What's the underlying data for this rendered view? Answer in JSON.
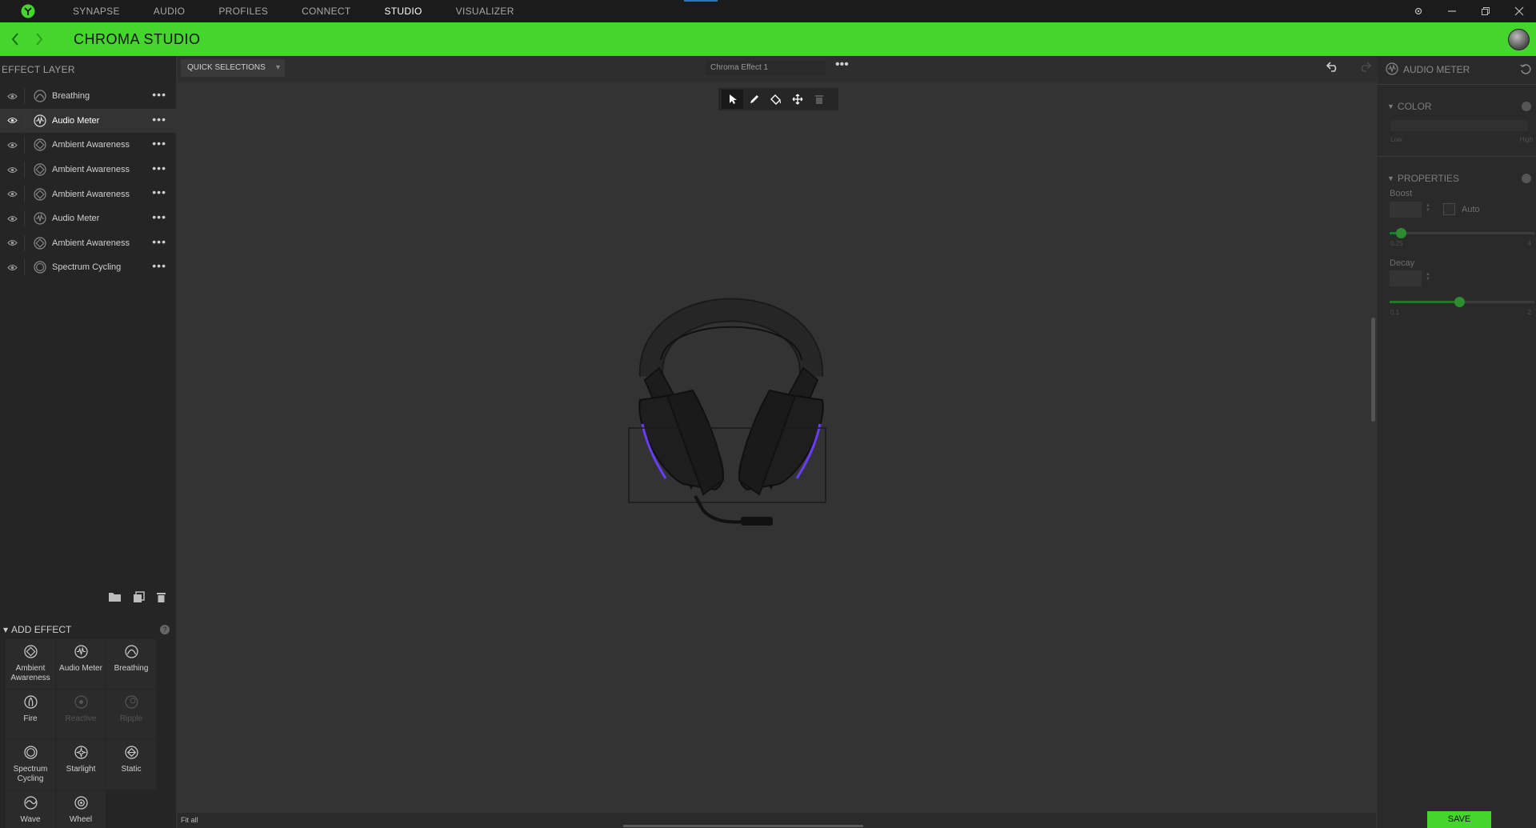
{
  "topnav": {
    "items": [
      "SYNAPSE",
      "AUDIO",
      "PROFILES",
      "CONNECT",
      "STUDIO",
      "VISUALIZER"
    ],
    "active": "STUDIO"
  },
  "header": {
    "title": "CHROMA STUDIO"
  },
  "left_panel": {
    "title": "EFFECT LAYER",
    "layers": [
      {
        "name": "Breathing",
        "icon": "breathing-icon"
      },
      {
        "name": "Audio Meter",
        "icon": "audio-meter-icon",
        "selected": true
      },
      {
        "name": "Ambient Awareness",
        "icon": "ambient-awareness-icon"
      },
      {
        "name": "Ambient Awareness",
        "icon": "ambient-awareness-icon"
      },
      {
        "name": "Ambient Awareness",
        "icon": "ambient-awareness-icon"
      },
      {
        "name": "Audio Meter",
        "icon": "audio-meter-icon"
      },
      {
        "name": "Ambient Awareness",
        "icon": "ambient-awareness-icon"
      },
      {
        "name": "Spectrum Cycling",
        "icon": "spectrum-cycling-icon"
      }
    ],
    "more_glyph": "•••",
    "add_effect_title": "ADD EFFECT",
    "effects": [
      {
        "line1": "Ambient",
        "line2": "Awareness",
        "enabled": true,
        "icon": "ambient-awareness-icon"
      },
      {
        "line1": "Audio Meter",
        "line2": "",
        "enabled": true,
        "icon": "audio-meter-icon"
      },
      {
        "line1": "Breathing",
        "line2": "",
        "enabled": true,
        "icon": "breathing-icon"
      },
      {
        "line1": "Fire",
        "line2": "",
        "enabled": true,
        "icon": "fire-icon"
      },
      {
        "line1": "Reactive",
        "line2": "",
        "enabled": false,
        "icon": "reactive-icon"
      },
      {
        "line1": "Ripple",
        "line2": "",
        "enabled": false,
        "icon": "ripple-icon"
      },
      {
        "line1": "Spectrum",
        "line2": "Cycling",
        "enabled": true,
        "icon": "spectrum-cycling-icon"
      },
      {
        "line1": "Starlight",
        "line2": "",
        "enabled": true,
        "icon": "starlight-icon"
      },
      {
        "line1": "Static",
        "line2": "",
        "enabled": true,
        "icon": "static-icon"
      },
      {
        "line1": "Wave",
        "line2": "",
        "enabled": true,
        "icon": "wave-icon"
      },
      {
        "line1": "Wheel",
        "line2": "",
        "enabled": true,
        "icon": "wheel-icon"
      }
    ]
  },
  "canvas": {
    "quick_selections": "QUICK SELECTIONS",
    "effect_name": "Chroma Effect 1",
    "more_glyph": "•••",
    "fit": "Fit all",
    "device": "headset",
    "accent_color": "#6a3cff"
  },
  "right_panel": {
    "title": "AUDIO METER",
    "color_section": "COLOR",
    "low": "Low",
    "high": "High",
    "properties_section": "PROPERTIES",
    "boost": {
      "label": "Boost",
      "auto": "Auto",
      "min": "0.25",
      "max": "4",
      "level": 0.08
    },
    "decay": {
      "label": "Decay",
      "min": "0.1",
      "max": "2",
      "level": 0.48
    },
    "save": "SAVE"
  },
  "colors": {
    "accent": "#44d62c",
    "topbar": "#1b1b1b",
    "panel": "#252525"
  }
}
